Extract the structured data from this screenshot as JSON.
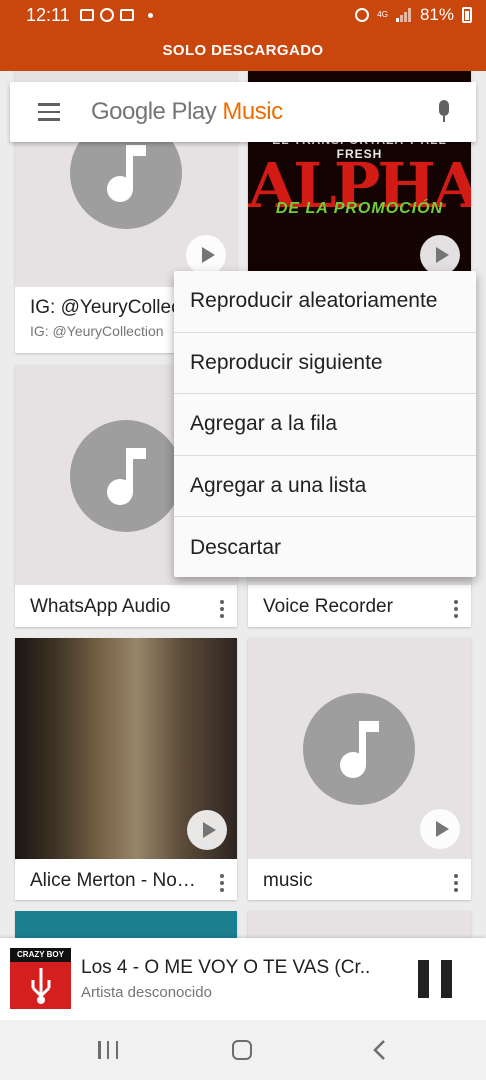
{
  "status_bar": {
    "time": "12:11",
    "network": "4G",
    "battery": "81%"
  },
  "banner": {
    "label": "SOLO DESCARGADO"
  },
  "search": {
    "logo_prefix": "Google Play",
    "logo_suffix": "Music"
  },
  "cards": [
    {
      "title": "IG: @YeuryCollection",
      "subtitle": "IG: @YeuryCollection"
    },
    {
      "title": "ALPHA",
      "subtitle": ""
    },
    {
      "title": "WhatsApp Audio",
      "subtitle": ""
    },
    {
      "title": "Voice Recorder",
      "subtitle": ""
    },
    {
      "title": "Alice Merton - No Roots",
      "subtitle": ""
    },
    {
      "title": "music",
      "subtitle": ""
    }
  ],
  "alpha_art": {
    "top_text": "EL TRANSPORTAZA Y ALL FRESH",
    "main_text": "ALPHA",
    "sub_text": "DE LA PROMOCIÓN"
  },
  "popup_menu": {
    "items": [
      "Reproducir aleatoriamente",
      "Reproducir siguiente",
      "Agregar a la fila",
      "Agregar a una lista",
      "Descartar"
    ]
  },
  "player": {
    "title": "Los 4 - O ME VOY O TE VAS  (Cr..",
    "artist": "Artista desconocido",
    "art_label": "CRAZY BOY"
  },
  "colors": {
    "accent": "#c9460d",
    "brand_orange": "#ef6c00",
    "placeholder_bg": "#e6e2e3",
    "note_disc": "#9e9e9e"
  }
}
